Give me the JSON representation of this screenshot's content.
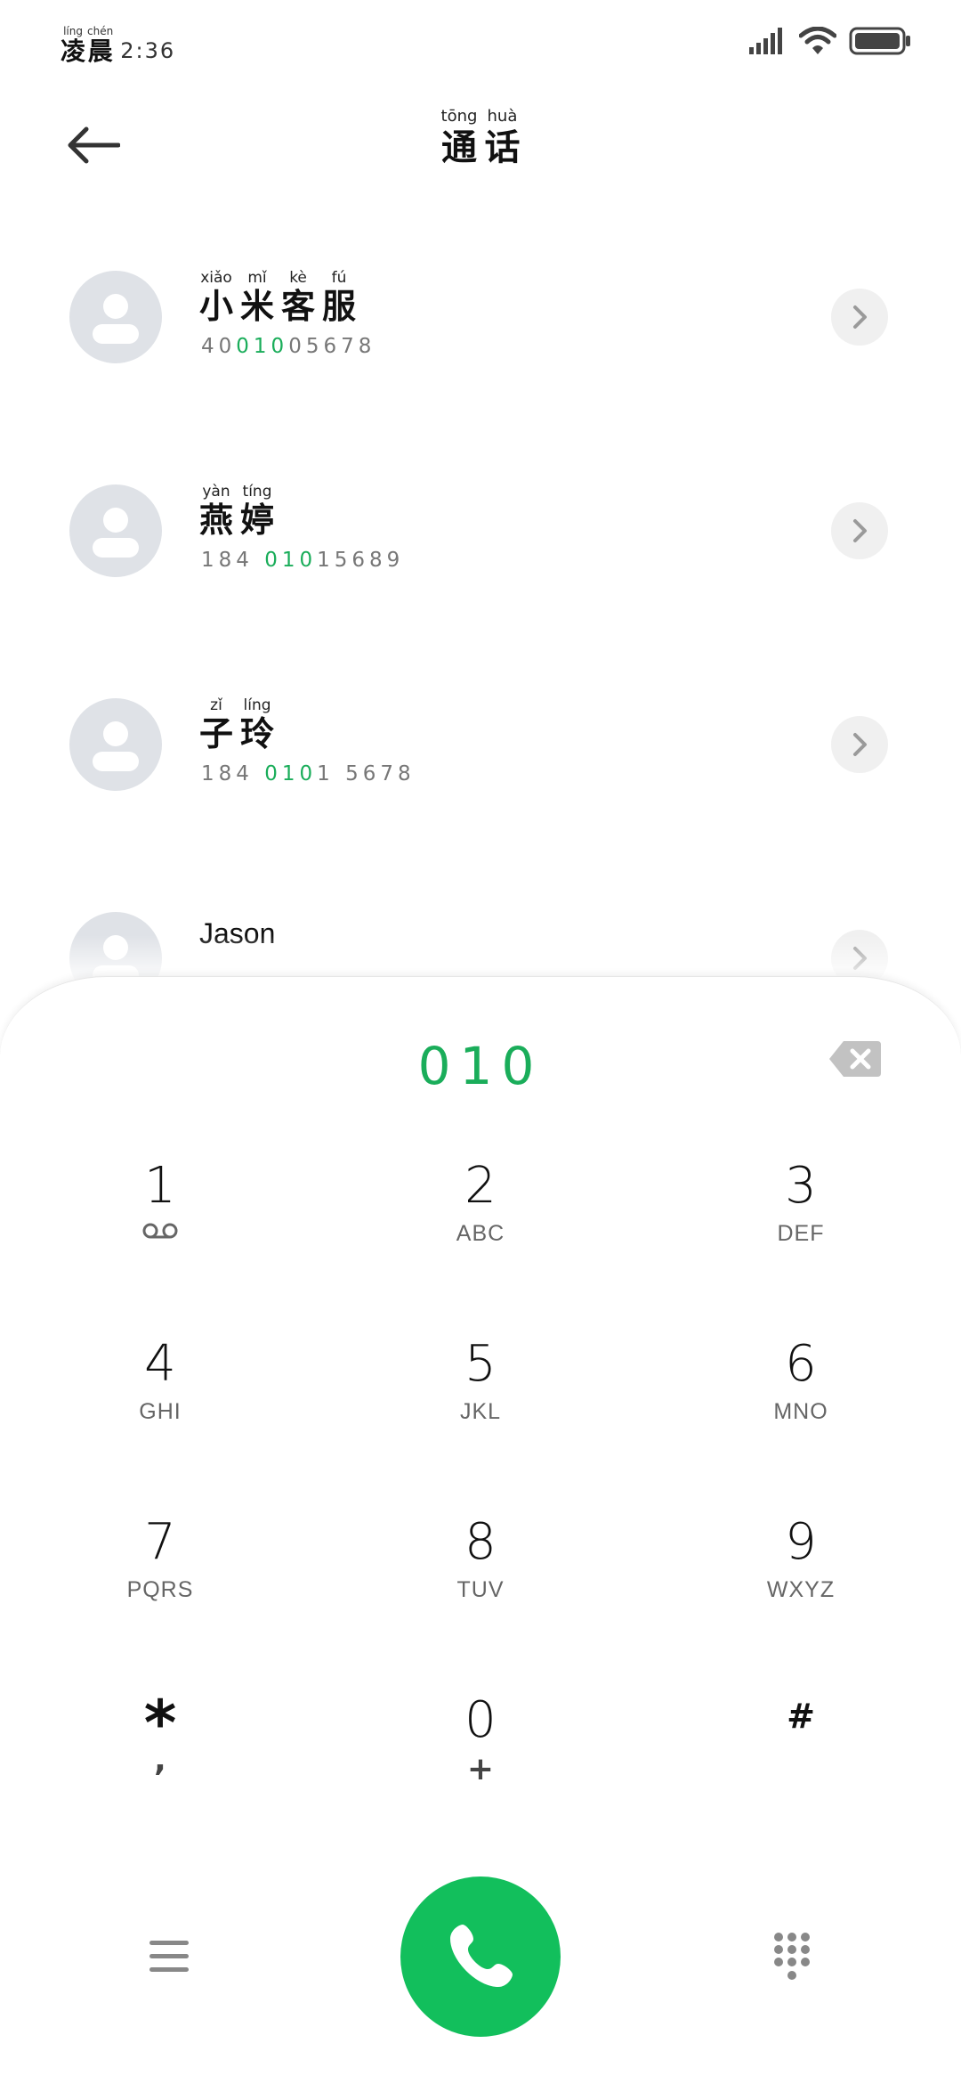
{
  "status_bar": {
    "period": [
      {
        "pinyin": "líng",
        "hanzi": "凌"
      },
      {
        "pinyin": "chén",
        "hanzi": "晨"
      }
    ],
    "time": "2:36",
    "icons": [
      "signal-icon",
      "wifi-icon",
      "battery-icon"
    ]
  },
  "header": {
    "back_icon": "arrow-left-icon",
    "title": [
      {
        "pinyin": "tōng",
        "hanzi": "通"
      },
      {
        "pinyin": "huà",
        "hanzi": "话"
      }
    ]
  },
  "contacts": [
    {
      "name_chars": [
        {
          "pinyin": "xiǎo",
          "hanzi": "小"
        },
        {
          "pinyin": "mǐ",
          "hanzi": "米"
        },
        {
          "pinyin": "kè",
          "hanzi": "客"
        },
        {
          "pinyin": "fú",
          "hanzi": "服"
        }
      ],
      "number_parts": [
        "40",
        "010",
        "05678"
      ]
    },
    {
      "name_chars": [
        {
          "pinyin": "yàn",
          "hanzi": "燕"
        },
        {
          "pinyin": "tíng",
          "hanzi": "婷"
        }
      ],
      "number_parts": [
        "184 ",
        "010",
        "15689"
      ]
    },
    {
      "name_chars": [
        {
          "pinyin": "zǐ",
          "hanzi": "子"
        },
        {
          "pinyin": "líng",
          "hanzi": "玲"
        }
      ],
      "number_parts": [
        "184 ",
        "010",
        "1 5678"
      ]
    },
    {
      "name_latin": "Jason"
    }
  ],
  "dialer": {
    "dialed_number": "010",
    "delete_icon": "backspace-icon",
    "keys": [
      {
        "digit": "1",
        "letters": "",
        "icon": "voicemail-icon"
      },
      {
        "digit": "2",
        "letters": "ABC"
      },
      {
        "digit": "3",
        "letters": "DEF"
      },
      {
        "digit": "4",
        "letters": "GHI"
      },
      {
        "digit": "5",
        "letters": "JKL"
      },
      {
        "digit": "6",
        "letters": "MNO"
      },
      {
        "digit": "7",
        "letters": "PQRS"
      },
      {
        "digit": "8",
        "letters": "TUV"
      },
      {
        "digit": "9",
        "letters": "WXYZ"
      },
      {
        "digit": "*",
        "letters": ","
      },
      {
        "digit": "0",
        "letters": "+"
      },
      {
        "digit": "#",
        "letters": ""
      }
    ],
    "accent_color": "#12bf5c",
    "highlight_color": "#1aad5a"
  },
  "bottom_bar": {
    "menu_icon": "menu-icon",
    "call_icon": "phone-icon",
    "dialpad_icon": "dialpad-grid-icon"
  }
}
